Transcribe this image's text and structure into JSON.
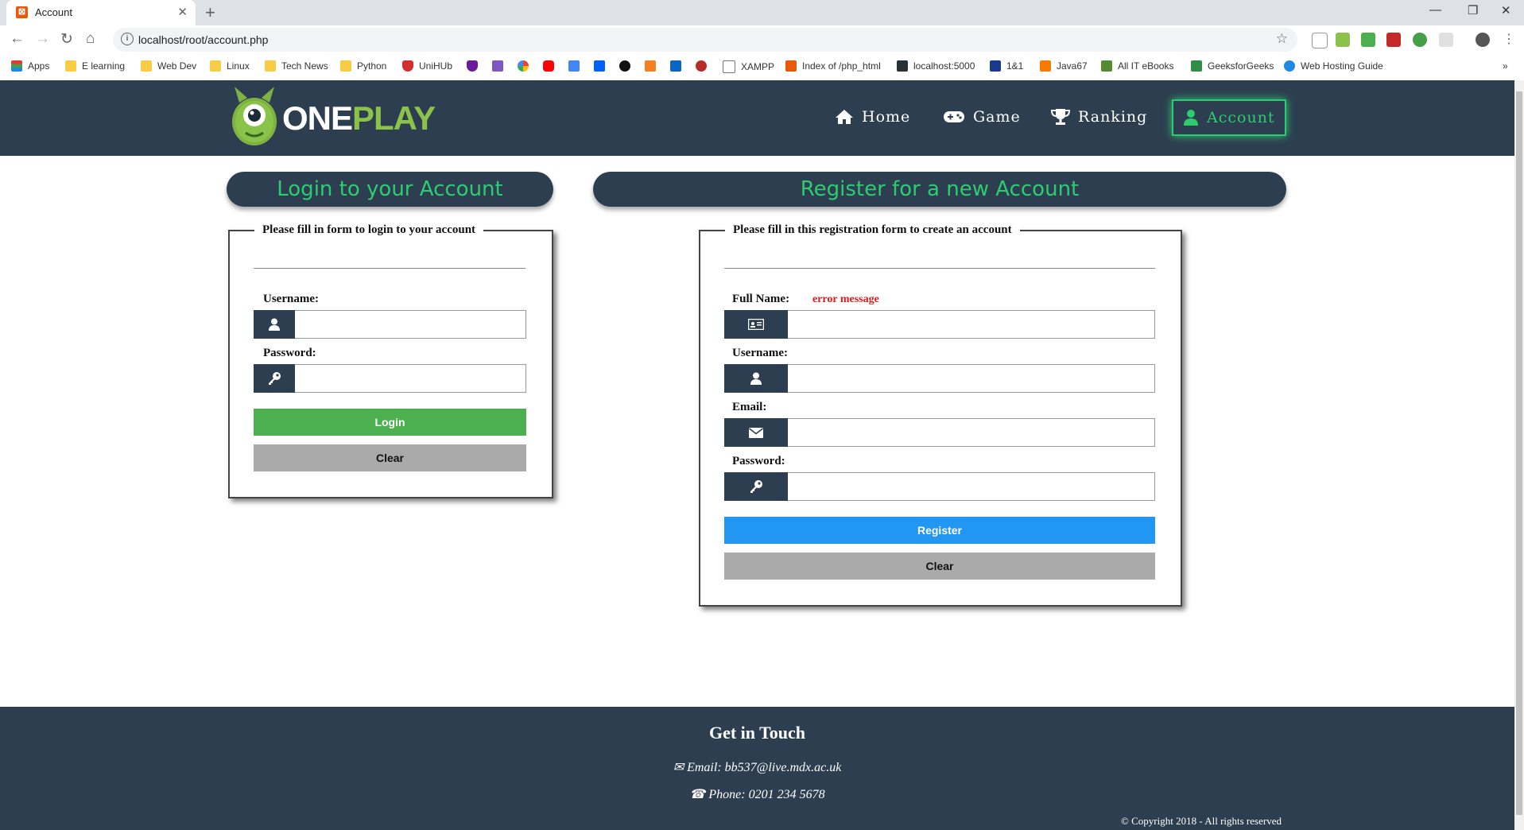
{
  "browser": {
    "tab_title": "Account",
    "url": "localhost/root/account.php",
    "bookmarks": [
      "Apps",
      "E learning",
      "Web Dev",
      "Linux",
      "Tech News",
      "Python",
      "UniHUb",
      "XAMPP",
      "Index of /php_html",
      "localhost:5000",
      "1&1",
      "Java67",
      "All IT eBooks",
      "GeeksforGeeks",
      "Web Hosting Guide"
    ]
  },
  "site": {
    "logo_part1": "ONE",
    "logo_part2": "PLAY",
    "nav": [
      {
        "label": "Home",
        "icon": "home-icon"
      },
      {
        "label": "Game",
        "icon": "gamepad-icon"
      },
      {
        "label": "Ranking",
        "icon": "trophy-icon"
      },
      {
        "label": "Account",
        "icon": "user-icon",
        "active": true
      }
    ]
  },
  "login": {
    "title": "Login to your Account",
    "legend": "Please fill in form to login to your account",
    "username_label": "Username:",
    "password_label": "Password:",
    "login_button": "Login",
    "clear_button": "Clear"
  },
  "register": {
    "title": "Register for a new Account",
    "legend": "Please fill in this registration form to create an account",
    "fullname_label": "Full Name:",
    "fullname_error": "error message",
    "username_label": "Username:",
    "email_label": "Email:",
    "password_label": "Password:",
    "register_button": "Register",
    "clear_button": "Clear"
  },
  "footer": {
    "heading": "Get in Touch",
    "email": "Email: bb537@live.mdx.ac.uk",
    "phone": "Phone: 0201 234 5678",
    "copyright": "© Copyright 2018 - All rights reserved"
  },
  "colors": {
    "header_bg": "#2c3e50",
    "accent_green": "#2ecc71",
    "login_button": "#4caf50",
    "register_button": "#2196f3",
    "clear_button": "#aaaaaa",
    "error": "#e01a1a"
  }
}
